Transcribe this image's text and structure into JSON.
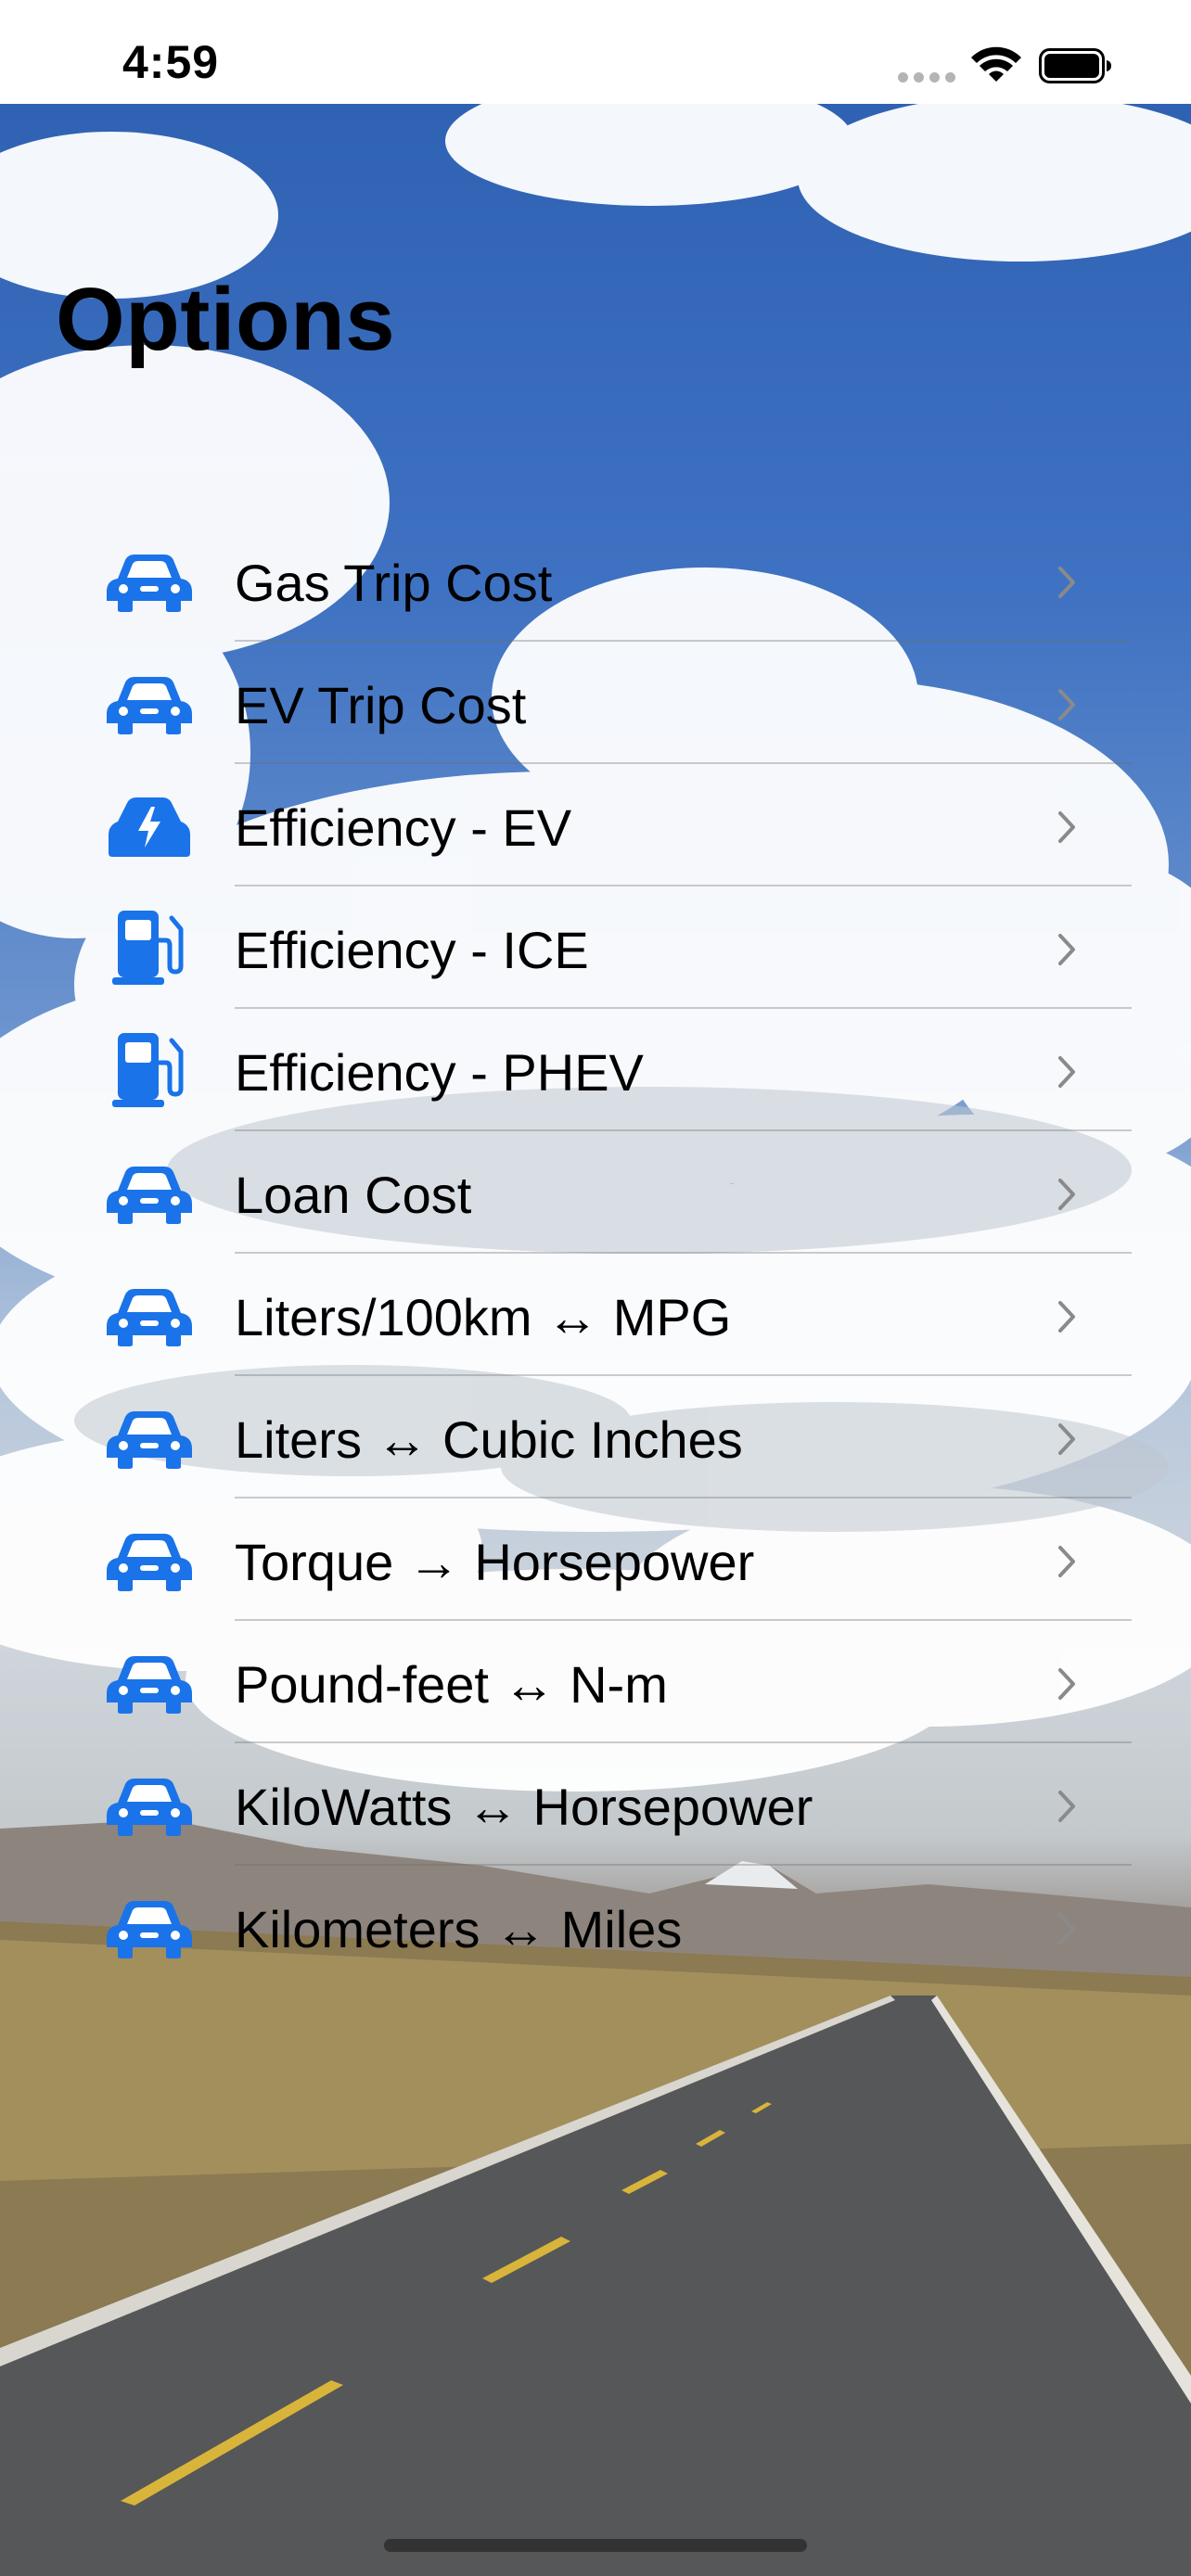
{
  "status_bar": {
    "time": "4:59",
    "icons": [
      "signal-dots",
      "wifi-icon",
      "battery-icon"
    ]
  },
  "page": {
    "title": "Options"
  },
  "colors": {
    "accent": "#1a73e8",
    "chevron": "#8a8a8a",
    "text": "#000000"
  },
  "options": [
    {
      "label": "Gas Trip Cost",
      "icon": "car-icon"
    },
    {
      "label": "EV Trip Cost",
      "icon": "car-icon"
    },
    {
      "label": "Efficiency - EV",
      "icon": "bolt-car-icon"
    },
    {
      "label": "Efficiency - ICE",
      "icon": "fuel-pump-icon"
    },
    {
      "label": "Efficiency - PHEV",
      "icon": "fuel-pump-icon"
    },
    {
      "label": "Loan Cost",
      "icon": "car-icon"
    },
    {
      "label": "Liters/100km ↔ MPG",
      "icon": "car-icon"
    },
    {
      "label": "Liters ↔ Cubic Inches",
      "icon": "car-icon"
    },
    {
      "label": "Torque → Horsepower",
      "icon": "car-icon"
    },
    {
      "label": "Pound-feet ↔ N-m",
      "icon": "car-icon"
    },
    {
      "label": "KiloWatts ↔ Horsepower",
      "icon": "car-icon"
    },
    {
      "label": "Kilometers ↔ Miles",
      "icon": "car-icon"
    }
  ]
}
